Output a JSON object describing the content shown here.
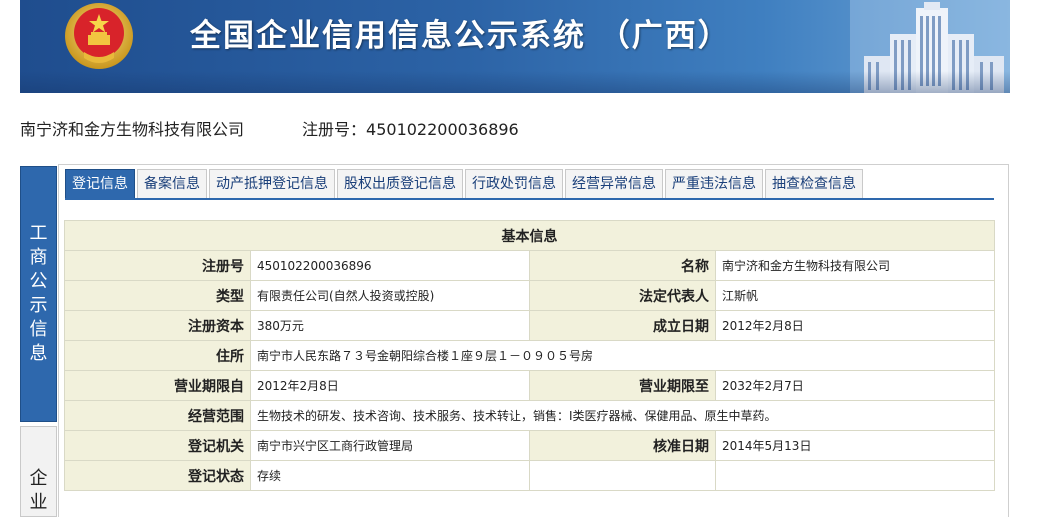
{
  "banner": {
    "title": "全国企业信用信息公示系统 （广西）"
  },
  "company": {
    "name": "南宁济和金方生物科技有限公司",
    "reg_label": "注册号：",
    "reg_no": "450102200036896"
  },
  "sidenav": {
    "active": "工商公示信息",
    "inactive": "企业"
  },
  "tabs": [
    {
      "label": "登记信息",
      "active": true
    },
    {
      "label": "备案信息"
    },
    {
      "label": "动产抵押登记信息"
    },
    {
      "label": "股权出质登记信息"
    },
    {
      "label": "行政处罚信息"
    },
    {
      "label": "经营异常信息"
    },
    {
      "label": "严重违法信息"
    },
    {
      "label": "抽查检查信息"
    }
  ],
  "basic": {
    "title": "基本信息",
    "reg_no": {
      "label": "注册号",
      "value": "450102200036896"
    },
    "name": {
      "label": "名称",
      "value": "南宁济和金方生物科技有限公司"
    },
    "type": {
      "label": "类型",
      "value": "有限责任公司(自然人投资或控股)"
    },
    "legal_rep": {
      "label": "法定代表人",
      "value": "江斯帆"
    },
    "capital": {
      "label": "注册资本",
      "value": "380万元"
    },
    "founded": {
      "label": "成立日期",
      "value": "2012年2月8日"
    },
    "address": {
      "label": "住所",
      "value": "南宁市人民东路７３号金朝阳综合楼１座９层１－０９０５号房"
    },
    "term_from": {
      "label": "营业期限自",
      "value": "2012年2月8日"
    },
    "term_to": {
      "label": "营业期限至",
      "value": "2032年2月7日"
    },
    "scope": {
      "label": "经营范围",
      "value": "生物技术的研发、技术咨询、技术服务、技术转让，销售：I类医疗器械、保健用品、原生中草药。"
    },
    "authority": {
      "label": "登记机关",
      "value": "南宁市兴宁区工商行政管理局"
    },
    "approved": {
      "label": "核准日期",
      "value": "2014年5月13日"
    },
    "status": {
      "label": "登记状态",
      "value": "存续"
    }
  }
}
